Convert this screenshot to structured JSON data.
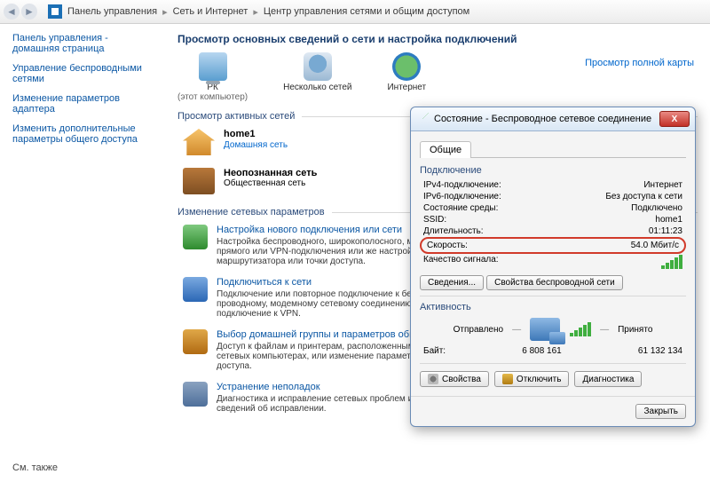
{
  "breadcrumb": {
    "items": [
      "Панель управления",
      "Сеть и Интернет",
      "Центр управления сетями и общим доступом"
    ]
  },
  "sidebar": {
    "links": [
      "Панель управления - домашняя страница",
      "Управление беспроводными сетями",
      "Изменение параметров адаптера",
      "Изменить дополнительные параметры общего доступа"
    ],
    "see_also": "См. также"
  },
  "main": {
    "heading": "Просмотр основных сведений о сети и настройка подключений",
    "full_map": "Просмотр полной карты",
    "map": {
      "pc_label": "РК",
      "pc_sub": "(этот компьютер)",
      "net_label": "Несколько сетей",
      "inet_label": "Интернет"
    },
    "sect_active": "Просмотр активных сетей",
    "networks": [
      {
        "title": "home1",
        "type_link": "Домашняя сеть"
      },
      {
        "title": "Неопознанная сеть",
        "type_text": "Общественная сеть"
      }
    ],
    "sect_params": "Изменение сетевых параметров",
    "tasks": [
      {
        "link": "Настройка нового подключения или сети",
        "desc": "Настройка беспроводного, широкополосного, модемного, прямого или VPN-подключения или же настройка маршрутизатора или точки доступа."
      },
      {
        "link": "Подключиться к сети",
        "desc": "Подключение или повторное подключение к беспроводному, проводному, модемному сетевому соединению или подключение к VPN."
      },
      {
        "link": "Выбор домашней группы и параметров общего доступа",
        "desc": "Доступ к файлам и принтерам, расположенным на других сетевых компьютерах, или изменение параметров общего доступа."
      },
      {
        "link": "Устранение неполадок",
        "desc": "Диагностика и исправление сетевых проблем или получение сведений об исправлении."
      }
    ]
  },
  "dialog": {
    "title": "Состояние - Беспроводное сетевое соединение",
    "tab": "Общие",
    "grp_conn": "Подключение",
    "rows": [
      {
        "k": "IPv4-подключение:",
        "v": "Интернет"
      },
      {
        "k": "IPv6-подключение:",
        "v": "Без доступа к сети"
      },
      {
        "k": "Состояние среды:",
        "v": "Подключено"
      },
      {
        "k": "SSID:",
        "v": "home1"
      },
      {
        "k": "Длительность:",
        "v": "01:11:23"
      }
    ],
    "speed_row": {
      "k": "Скорость:",
      "v": "54.0 Мбит/с"
    },
    "signal_label": "Качество сигнала:",
    "btn_details": "Сведения...",
    "btn_wprops": "Свойства беспроводной сети",
    "grp_act": "Активность",
    "sent": "Отправлено",
    "recv": "Принято",
    "bytes_label": "Байт:",
    "bytes_sent": "6 808 161",
    "bytes_recv": "61 132 134",
    "btn_props": "Свойства",
    "btn_disc": "Отключить",
    "btn_diag": "Диагностика",
    "btn_close": "Закрыть"
  }
}
